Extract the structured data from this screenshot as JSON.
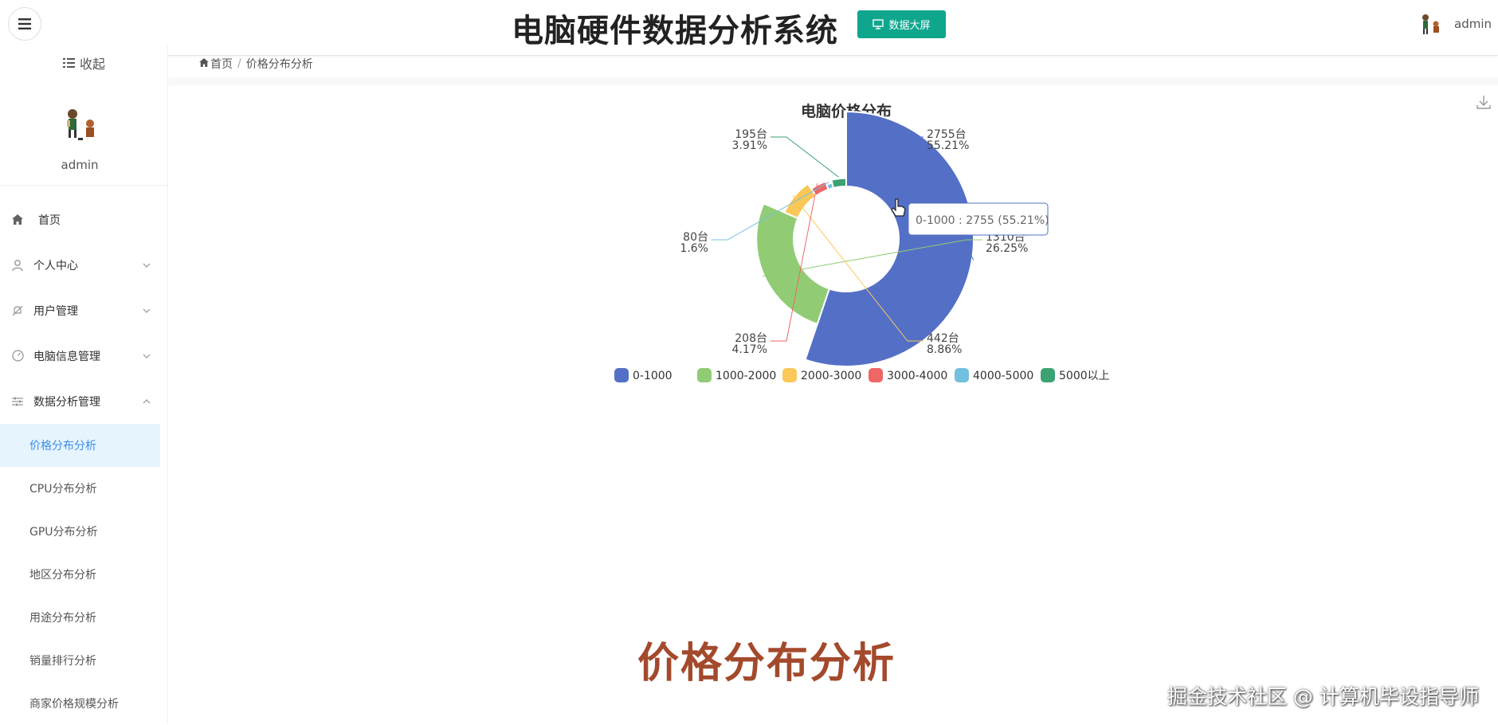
{
  "header": {
    "title": "电脑硬件数据分析系统",
    "screen_button": "数据大屏",
    "username": "admin"
  },
  "sidebar": {
    "collapse_label": "收起",
    "username": "admin",
    "items": [
      {
        "label": "首页",
        "icon": "home-icon"
      },
      {
        "label": "个人中心",
        "icon": "user-icon"
      },
      {
        "label": "用户管理",
        "icon": "bell-off-icon"
      },
      {
        "label": "电脑信息管理",
        "icon": "dashboard-icon"
      },
      {
        "label": "数据分析管理",
        "icon": "sliders-icon"
      }
    ],
    "subitems": [
      {
        "label": "价格分布分析"
      },
      {
        "label": "CPU分布分析"
      },
      {
        "label": "GPU分布分析"
      },
      {
        "label": "地区分布分析"
      },
      {
        "label": "用途分布分析"
      },
      {
        "label": "销量排行分析"
      },
      {
        "label": "商家价格规模分析"
      }
    ]
  },
  "breadcrumb": {
    "home": "首页",
    "separator": "/",
    "current": "价格分布分析"
  },
  "caption": "价格分布分析",
  "watermark": "掘金技术社区 @ 计算机毕设指导师",
  "chart_data": {
    "type": "pie",
    "subtype": "nightingale-rose",
    "title": "电脑价格分布",
    "categories": [
      "0-1000",
      "1000-2000",
      "2000-3000",
      "3000-4000",
      "4000-5000",
      "5000以上"
    ],
    "values": [
      2755,
      1310,
      442,
      208,
      80,
      195
    ],
    "labels": [
      "2755台",
      "1310台",
      "442台",
      "208台",
      "80台",
      "195台"
    ],
    "percents": [
      "55.21%",
      "26.25%",
      "8.86%",
      "4.17%",
      "1.6%",
      "3.91%"
    ],
    "colors": [
      "#5470c6",
      "#91cc75",
      "#fac858",
      "#ee6666",
      "#73c0de",
      "#3ba272"
    ],
    "legend_position": "bottom",
    "tooltip": "0-1000 : 2755 (55.21%)"
  }
}
